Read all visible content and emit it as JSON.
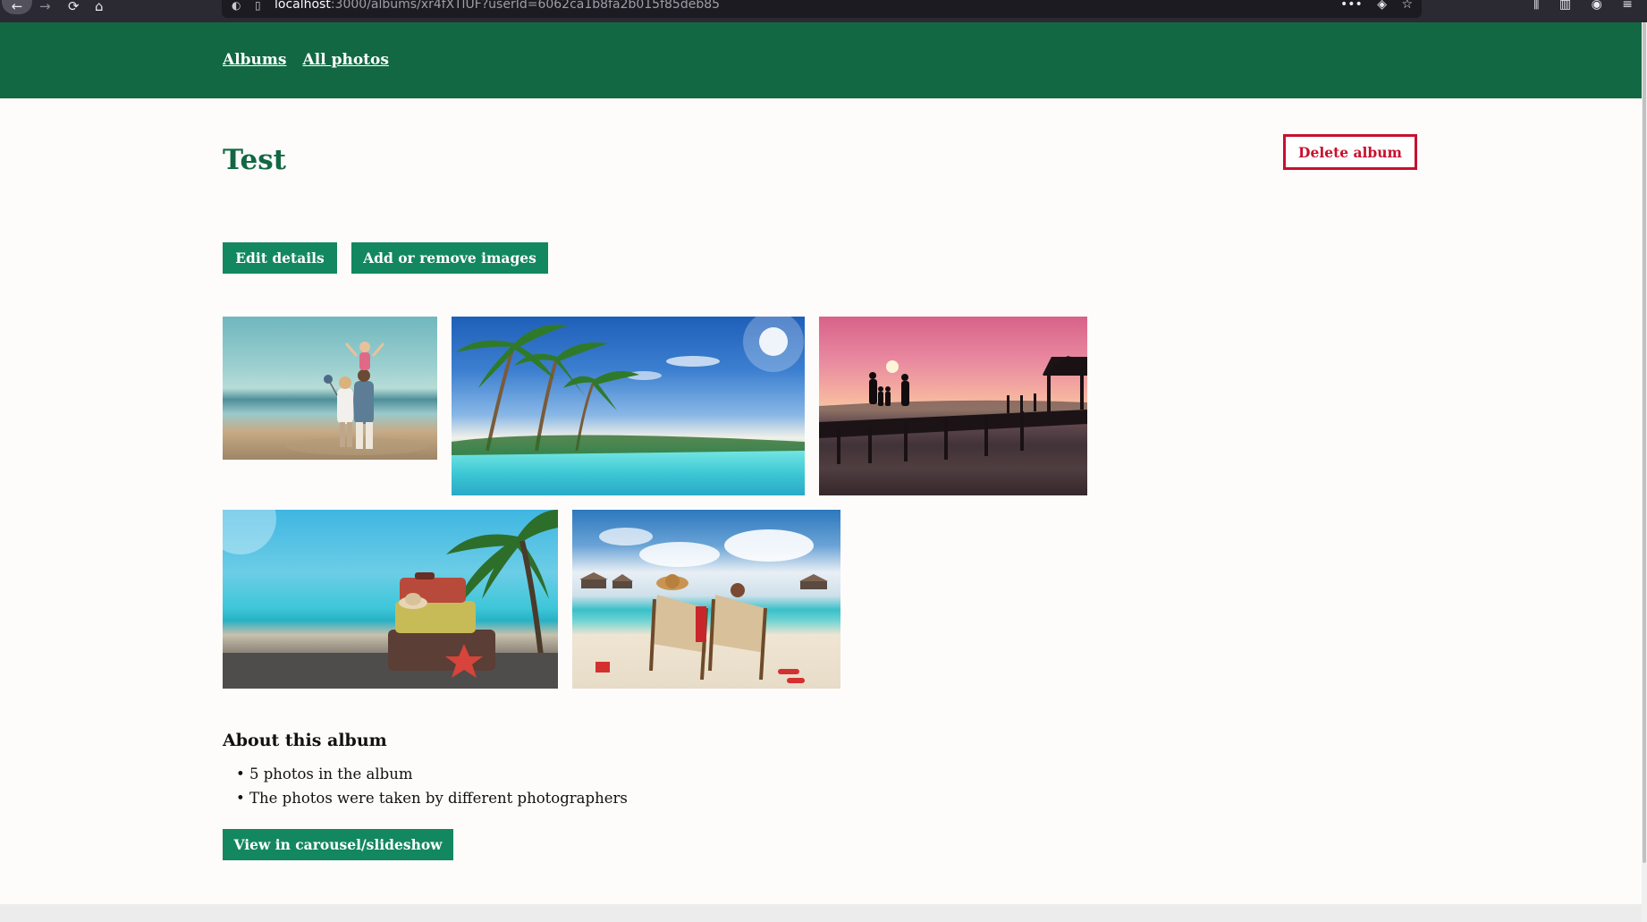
{
  "browser": {
    "back_icon": "←",
    "forward_icon": "→",
    "reload_icon": "⟳",
    "home_icon": "⌂",
    "url_host": "localhost",
    "url_path": ":3000/albums/xr4fXTlUF?userId=6062ca1b8fa2b015f85deb85",
    "more_icon": "•••",
    "pocket_icon": "◈",
    "bookmark_icon": "☆",
    "library_icon": "⫼",
    "sidebar_icon": "▥",
    "account_icon": "◉",
    "menu_icon": "≡"
  },
  "header": {
    "nav": [
      "Albums",
      "All photos"
    ]
  },
  "album": {
    "title": "Test",
    "delete_label": "Delete album",
    "edit_label": "Edit details",
    "add_remove_label": "Add or remove images",
    "photos": [
      {
        "alt": "family-on-beach"
      },
      {
        "alt": "palm-beach"
      },
      {
        "alt": "sunset-pier"
      },
      {
        "alt": "suitcases-palm"
      },
      {
        "alt": "beach-chairs"
      }
    ]
  },
  "about": {
    "heading": "About this album",
    "items": [
      "5 photos in the album",
      "The photos were taken by different photographers"
    ],
    "carousel_label": "View in carousel/slideshow"
  }
}
